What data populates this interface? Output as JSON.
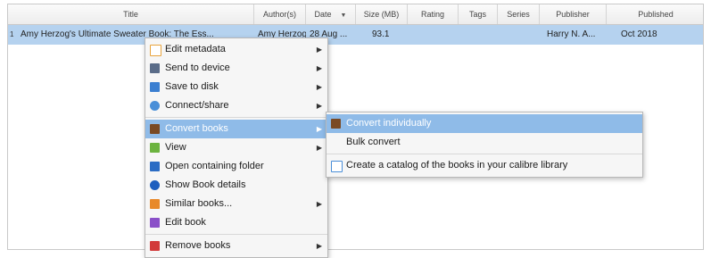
{
  "table": {
    "columns": [
      "Title",
      "Author(s)",
      "Date",
      "Size (MB)",
      "Rating",
      "Tags",
      "Series",
      "Publisher",
      "Published"
    ],
    "sort_indicator": "▼",
    "row": {
      "number": "1",
      "title": "Amy Herzog's Ultimate Sweater Book: The Ess...",
      "authors": "Amy Herzog",
      "date": "28 Aug ...",
      "size": "93.1",
      "rating": "",
      "tags": "",
      "series": "",
      "publisher": "Harry N. A...",
      "published": "Oct 2018"
    }
  },
  "context_menu": {
    "items": [
      {
        "label": "Edit metadata",
        "icon": "edit-metadata-icon",
        "color": "#e8a33c",
        "submenu": true
      },
      {
        "label": "Send to device",
        "icon": "send-device-icon",
        "color": "#5a6c88",
        "submenu": true
      },
      {
        "label": "Save to disk",
        "icon": "save-disk-icon",
        "color": "#3b7fd1",
        "submenu": true
      },
      {
        "label": "Connect/share",
        "icon": "connect-share-icon",
        "color": "#4a8fd8",
        "submenu": true
      },
      {
        "label": "Convert books",
        "icon": "convert-books-icon",
        "color": "#7a4a24",
        "submenu": true
      },
      {
        "label": "View",
        "icon": "view-icon",
        "color": "#6cb33f",
        "submenu": true
      },
      {
        "label": "Open containing folder",
        "icon": "folder-icon",
        "color": "#2b6cc4",
        "submenu": false
      },
      {
        "label": "Show Book details",
        "icon": "info-icon",
        "color": "#1f5fbf",
        "submenu": false
      },
      {
        "label": "Similar books...",
        "icon": "similar-books-icon",
        "color": "#e8892a",
        "submenu": true
      },
      {
        "label": "Edit book",
        "icon": "edit-book-icon",
        "color": "#8a4fc8",
        "submenu": false
      },
      {
        "label": "Remove books",
        "icon": "remove-books-icon",
        "color": "#d23a3a",
        "submenu": true
      }
    ],
    "highlighted_index": 4
  },
  "convert_submenu": {
    "items": [
      {
        "label": "Convert individually",
        "icon": "convert-individually-icon",
        "color": "#7a4a24"
      },
      {
        "label": "Bulk convert",
        "icon": "",
        "color": ""
      },
      {
        "label": "Create a catalog of the books in your calibre library",
        "icon": "catalog-icon",
        "color": "#4a8fd8"
      }
    ],
    "highlighted_index": 0
  },
  "colors": {
    "selection": "#b5d2ef",
    "menu_highlight": "#8fbbe8"
  }
}
